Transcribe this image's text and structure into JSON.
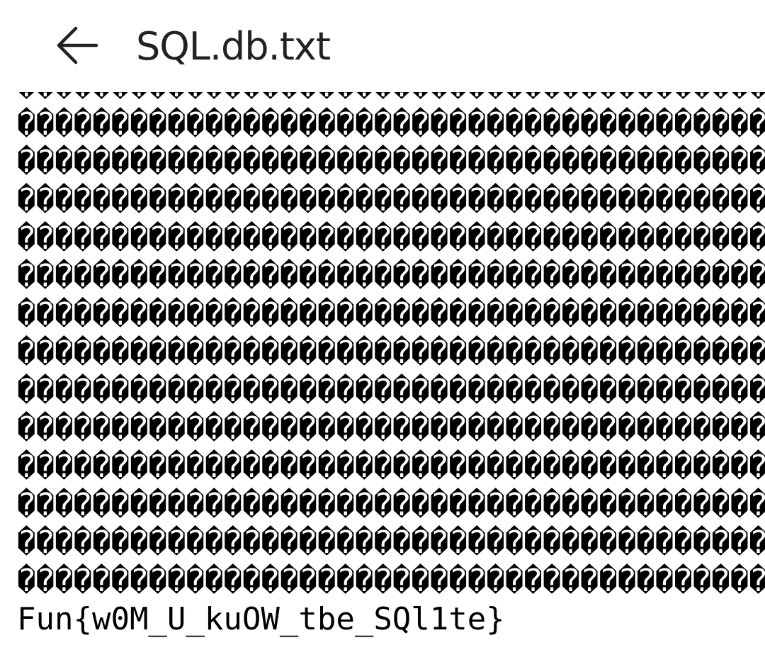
{
  "header": {
    "back_icon": "arrow-left-icon",
    "title": "SQL.db.txt"
  },
  "content": {
    "garbled_lines": [
      "��������������������������������������������",
      "��������������������������������������������",
      "��������������������������������������������",
      "��������������������������������������������",
      "��������������������������������������������",
      "��������������������������������������������",
      "��������������������������������������������",
      "��������������������������������������������",
      "��������������������������������������������",
      "��������������������������������������������",
      "��������������������������������������������",
      "��������������������������������������������",
      "��������������������������������������������",
      "��������������������������������������������"
    ],
    "flag_line": "Fun{w0M_U_kuOW_tbe_SQl1te}"
  }
}
